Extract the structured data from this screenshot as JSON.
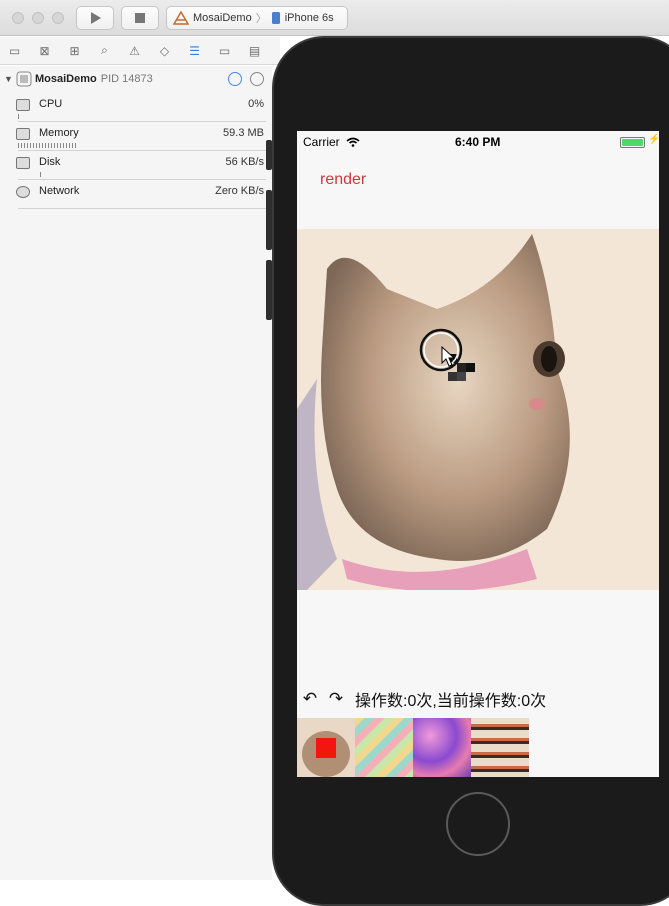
{
  "toolbar": {
    "scheme_app": "MosaiDemo",
    "scheme_device": "iPhone 6s"
  },
  "debug_navigator": {
    "process_name": "MosaiDemo",
    "process_pid": "PID 14873",
    "gauges": [
      {
        "label": "CPU",
        "value": "0%",
        "icon": "cpu-icon"
      },
      {
        "label": "Memory",
        "value": "59.3 MB",
        "icon": "memory-icon"
      },
      {
        "label": "Disk",
        "value": "56 KB/s",
        "icon": "disk-icon"
      },
      {
        "label": "Network",
        "value": "Zero KB/s",
        "icon": "network-icon"
      }
    ]
  },
  "simulator": {
    "status": {
      "carrier": "Carrier",
      "time": "6:40 PM"
    },
    "render_label": "render",
    "ops_text": "操作数:0次,当前操作数:0次",
    "undo_icon": "undo-icon",
    "redo_icon": "redo-icon",
    "colors": {
      "accent": "#d0363a",
      "battery": "#4cd964"
    }
  }
}
